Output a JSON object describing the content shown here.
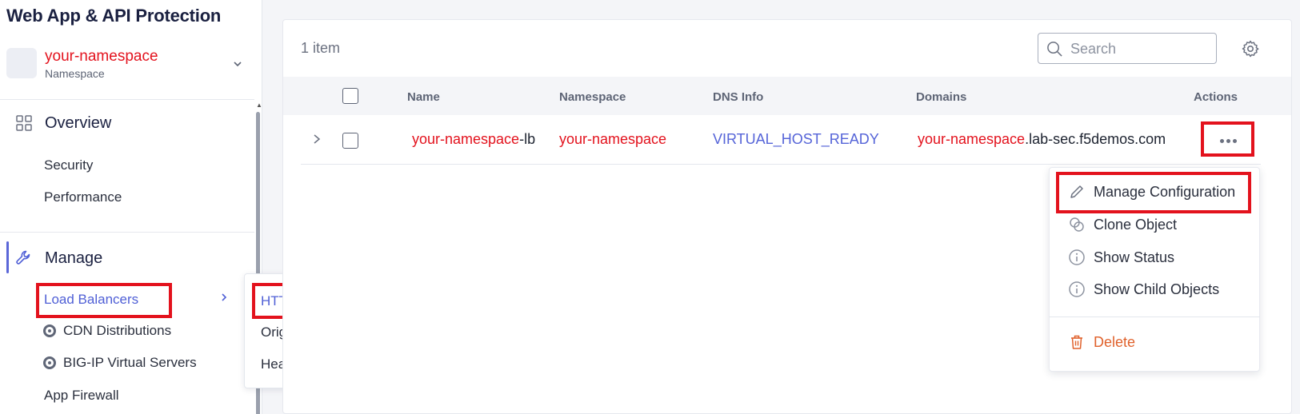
{
  "app": {
    "title": "Web App & API Protection"
  },
  "namespace": {
    "name": "your-namespace",
    "label": "Namespace"
  },
  "sidebar": {
    "overview": {
      "label": "Overview",
      "items": [
        "Security",
        "Performance"
      ]
    },
    "manage": {
      "label": "Manage",
      "items": {
        "load_balancers": "Load Balancers",
        "cdn": "CDN Distributions",
        "bigip": "BIG-IP Virtual Servers",
        "app_firewall": "App Firewall"
      }
    }
  },
  "submenu": {
    "items": [
      "HTTP Load Balancers",
      "Origin Pools",
      "Health Checks"
    ],
    "active_index": 0
  },
  "table": {
    "count_label": "1 item",
    "search_placeholder": "Search",
    "columns": [
      "Name",
      "Namespace",
      "DNS Info",
      "Domains",
      "Actions"
    ],
    "rows": [
      {
        "name_prefix": "your-namespace",
        "name_suffix": "-lb",
        "namespace": "your-namespace",
        "dns_info": "VIRTUAL_HOST_READY",
        "domain_prefix": "your-namespace",
        "domain_suffix": ".lab-sec.f5demos.com"
      }
    ]
  },
  "actions_menu": {
    "items": [
      "Manage Configuration",
      "Clone Object",
      "Show Status",
      "Show Child Objects"
    ],
    "danger_item": "Delete"
  },
  "colors": {
    "accent": "#4f5fd6",
    "highlight": "#e3121d",
    "danger": "#e0612b",
    "dns_status": "#5564d8"
  }
}
